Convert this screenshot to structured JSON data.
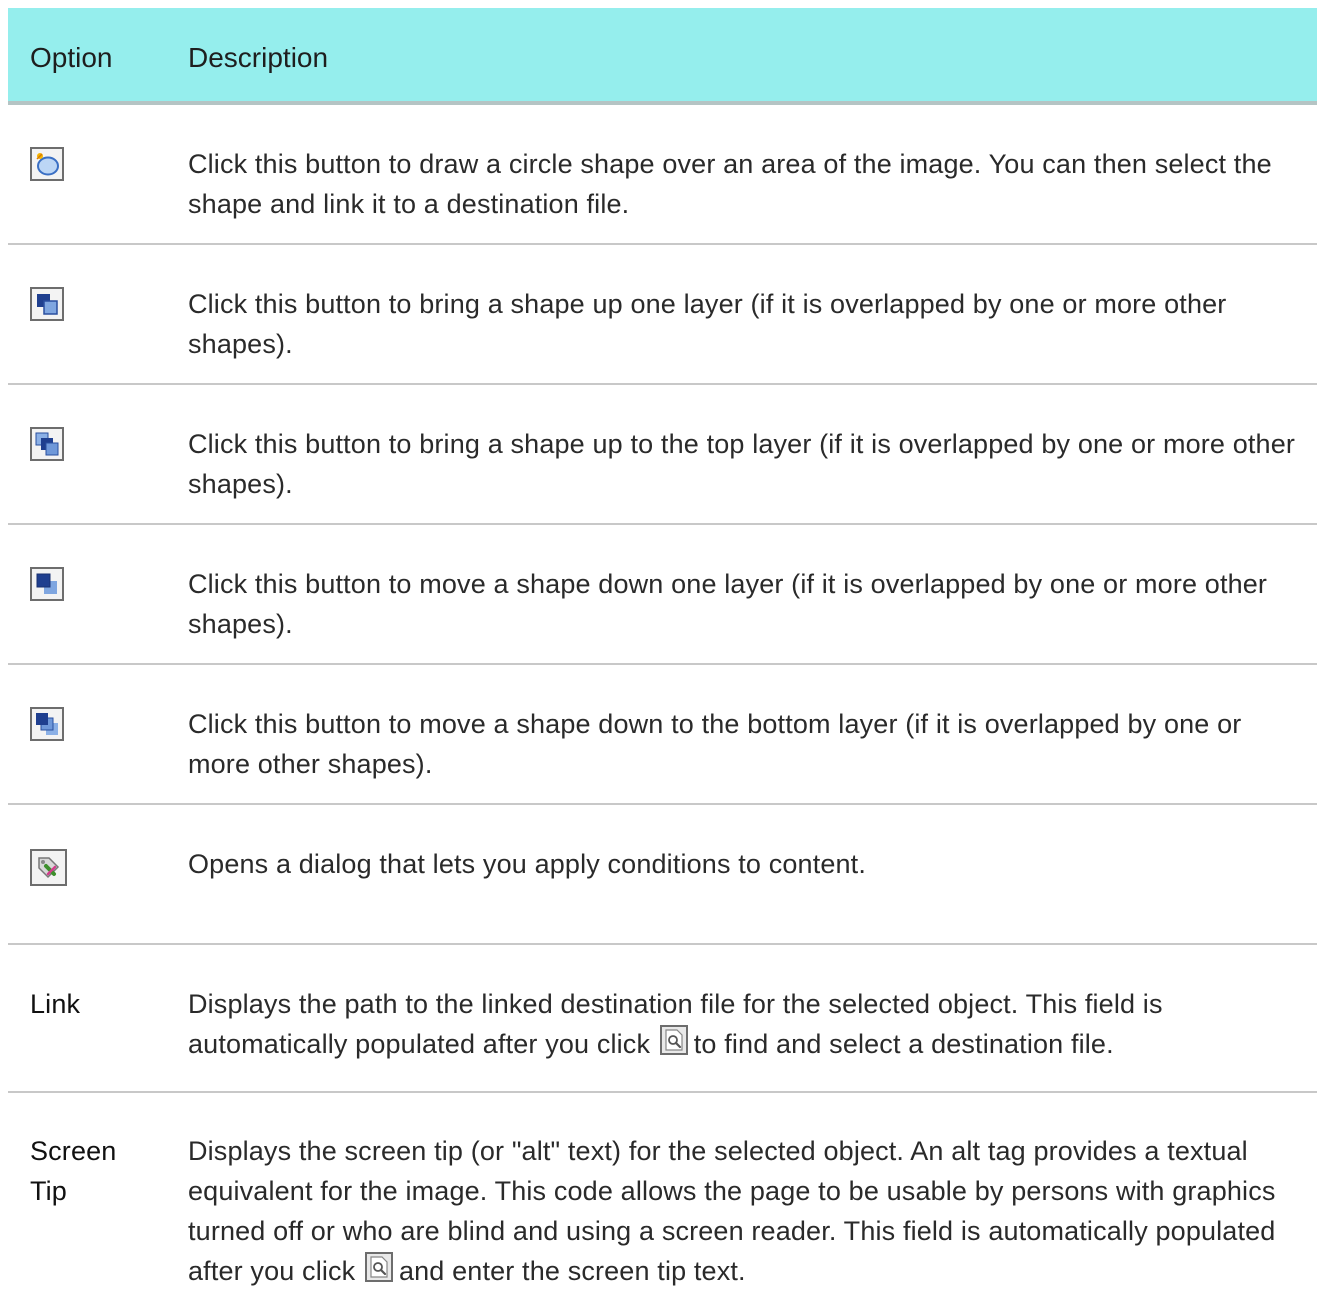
{
  "table": {
    "header": {
      "option": "Option",
      "description": "Description"
    },
    "rows": [
      {
        "icon": "draw-circle-icon",
        "description": "Click this button to draw a circle shape over an area of the image. You can then select the shape and link it to a destination file."
      },
      {
        "icon": "bring-forward-icon",
        "description": "Click this button to bring a shape up one layer (if it is overlapped by one or more other shapes)."
      },
      {
        "icon": "bring-to-front-icon",
        "description": "Click this button to bring a shape up to the top layer (if it is overlapped by one or more other shapes)."
      },
      {
        "icon": "send-backward-icon",
        "description": "Click this button to move a shape down one layer (if it is overlapped by one or more other shapes)."
      },
      {
        "icon": "send-to-back-icon",
        "description": "Click this button to move a shape down to the bottom layer (if it is overlapped by one or more other shapes)."
      },
      {
        "icon": "conditions-tag-icon",
        "description": "Opens a dialog that lets you apply conditions to content."
      }
    ],
    "link_row": {
      "label": "Link",
      "desc_before": "Displays the path to the linked destination file for the selected object. This field is automatically populated after you click",
      "inline_icon": "browse-file-icon",
      "desc_after": "to find and select a destination file."
    },
    "tip_row": {
      "label": "Screen Tip",
      "desc_before": "Displays the screen tip (or \"alt\" text) for the selected object. An alt tag provides a textual equivalent for the image. This code allows the page to be usable by persons with graphics turned off or who are blind and using a screen reader. This field is automatically populated after you click",
      "inline_icon": "browse-file-icon",
      "desc_after": "and enter the screen tip text."
    }
  },
  "colors": {
    "header_background": "#95eeed",
    "row_divider": "#c8c8c8",
    "icon_blue": "#3a6fc4"
  }
}
